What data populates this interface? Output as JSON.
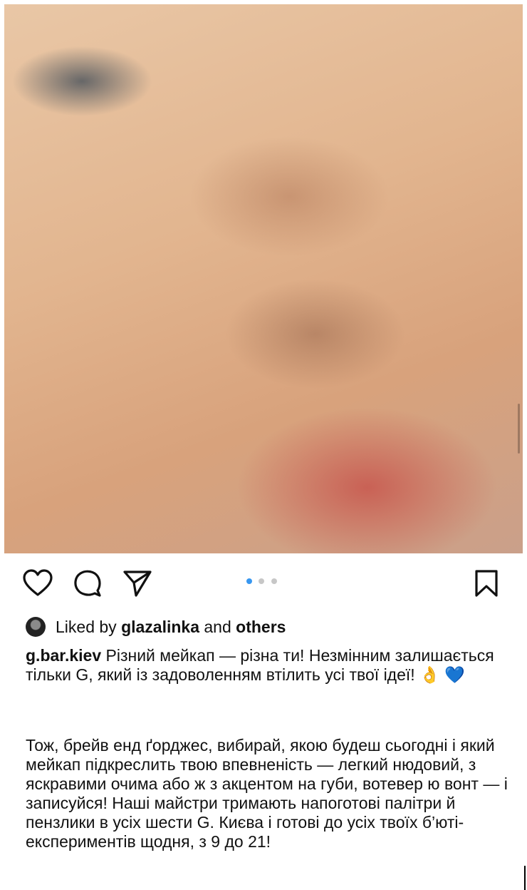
{
  "post": {
    "image": {
      "alt_icon": "photo"
    },
    "carousel": {
      "count": 3,
      "active_index": 0,
      "active_color": "#3897f0",
      "inactive_color": "#c7c7c7"
    }
  },
  "actions": {
    "like_icon": "heart-icon",
    "comment_icon": "comment-icon",
    "share_icon": "paper-plane-icon",
    "save_icon": "bookmark-icon"
  },
  "likes": {
    "prefix": "Liked by",
    "user": "glazalinka",
    "and": "and",
    "others": "others"
  },
  "caption": {
    "username": "g.bar.kiev",
    "text": " Різний мейкап — різна ти! Незмінним залишається тільки G, який із задоволенням втілить усі твої ідеї! 👌 💙",
    "paragraph2": "Тож, брейв енд ґорджес, вибирай, якою будеш сьогодні і який мейкап підкреслить твою впевненість — легкий нюдовий, з яскравими очима або ж з акцентом на губи, вотевер ю вонт — і записуйся! Наші майстри тримають напоготові палітри й пензлики в усіх шести G. Києва і готові до усіх твоїх б’юті-експериментів щодня, з 9 до 21!"
  }
}
